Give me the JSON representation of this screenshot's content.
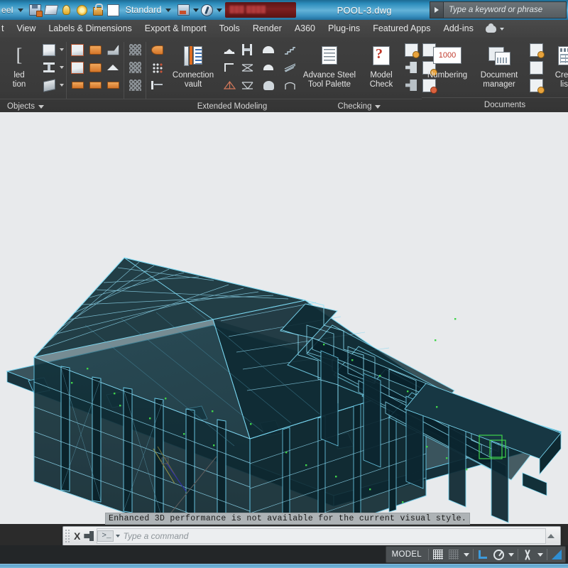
{
  "titlebar": {
    "workspace_label": "eel",
    "style_label": "Standard",
    "document_title": "POOL-3.dwg",
    "search_placeholder": "Type a keyword or phrase",
    "icons": [
      "save-icon",
      "plot-icon",
      "bulb-icon",
      "sun-icon",
      "lock-icon",
      "color-swatch",
      "layer-icon",
      "globe-icon"
    ]
  },
  "menubar": {
    "items": [
      {
        "label": "t"
      },
      {
        "label": "View"
      },
      {
        "label": "Labels & Dimensions"
      },
      {
        "label": "Export & Import"
      },
      {
        "label": "Tools"
      },
      {
        "label": "Render"
      },
      {
        "label": "A360"
      },
      {
        "label": "Plug-ins"
      },
      {
        "label": "Featured Apps"
      },
      {
        "label": "Add-ins"
      }
    ]
  },
  "ribbon": {
    "panels": [
      {
        "label": "Objects",
        "has_dropdown": true
      },
      {
        "label": "Extended Modeling",
        "has_dropdown": false
      },
      {
        "label": "Checking",
        "has_dropdown": true
      },
      {
        "label": "Documents",
        "has_dropdown": false
      }
    ],
    "buttons": {
      "beveled_section": "led\ntion",
      "connection_vault_line1": "Connection",
      "connection_vault_line2": "vault",
      "advance_steel_line1": "Advance Steel",
      "advance_steel_line2": "Tool Palette",
      "model_check_line1": "Model",
      "model_check_line2": "Check",
      "numbering": "Numbering",
      "document_manager_line1": "Document",
      "document_manager_line2": "manager",
      "create_lists_line1": "Create",
      "create_lists_line2": "lists",
      "numbering_value": "1000"
    }
  },
  "viewport": {
    "tooltip_message": "Enhanced 3D performance is not available for the current visual style.",
    "background_color": "#e8eaec",
    "model_edge_color": "#5fc3e4",
    "model_fill_color": "#123038",
    "highlight_color": "#3fd44a",
    "ucs_icon": "ucs-axes-icon"
  },
  "commandline": {
    "placeholder": "Type a command",
    "prompt_glyph": ">_",
    "close_glyph": "X",
    "customize_icon": "wrench-icon"
  },
  "statusbar": {
    "model_label": "MODEL",
    "toggles": [
      {
        "name": "grid-display",
        "state": "on"
      },
      {
        "name": "snap-mode",
        "state": "off"
      },
      {
        "name": "ortho-mode",
        "state": "on"
      },
      {
        "name": "polar-tracking",
        "state": "on"
      },
      {
        "name": "object-snap",
        "state": "on"
      },
      {
        "name": "object-snap-tracking",
        "state": "on"
      }
    ]
  }
}
